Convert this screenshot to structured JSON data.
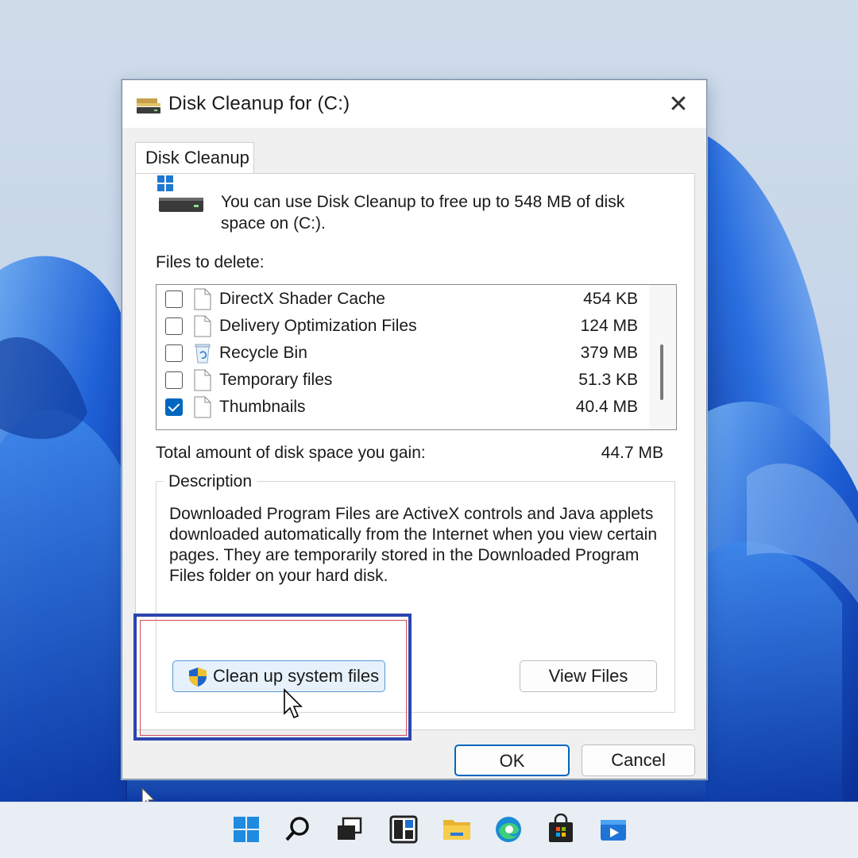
{
  "window": {
    "title": "Disk Cleanup for  (C:)"
  },
  "tabs": [
    {
      "label": "Disk Cleanup",
      "selected": true
    }
  ],
  "intro_text": "You can use Disk Cleanup to free up to 548 MB of disk space on  (C:).",
  "files_to_delete_label": "Files to delete:",
  "files": [
    {
      "name": "DirectX Shader Cache",
      "size": "454 KB",
      "checked": false,
      "icon": "file-icon"
    },
    {
      "name": "Delivery Optimization Files",
      "size": "124 MB",
      "checked": false,
      "icon": "file-icon"
    },
    {
      "name": "Recycle Bin",
      "size": "379 MB",
      "checked": false,
      "icon": "recycle-bin-icon"
    },
    {
      "name": "Temporary files",
      "size": "51.3 KB",
      "checked": false,
      "icon": "file-icon"
    },
    {
      "name": "Thumbnails",
      "size": "40.4 MB",
      "checked": true,
      "icon": "file-icon"
    }
  ],
  "total_label": "Total amount of disk space you gain:",
  "total_value": "44.7 MB",
  "description": {
    "legend": "Description",
    "text": "Downloaded Program Files are ActiveX controls and Java applets downloaded automatically from the Internet when you view certain pages. They are temporarily stored in the Downloaded Program Files folder on your hard disk."
  },
  "buttons": {
    "cleanup_system_files": "Clean up system files",
    "view_files": "View Files",
    "ok": "OK",
    "cancel": "Cancel"
  },
  "taskbar_icons": [
    "start-icon",
    "search-icon",
    "task-view-icon",
    "widgets-icon",
    "file-explorer-icon",
    "edge-icon",
    "store-icon",
    "media-player-icon"
  ],
  "colors": {
    "accent": "#0067c0",
    "highlight_border": "#2c44b0",
    "highlight_inner": "#d24a5a",
    "wallpaper_blue": "#1e5fd6"
  }
}
